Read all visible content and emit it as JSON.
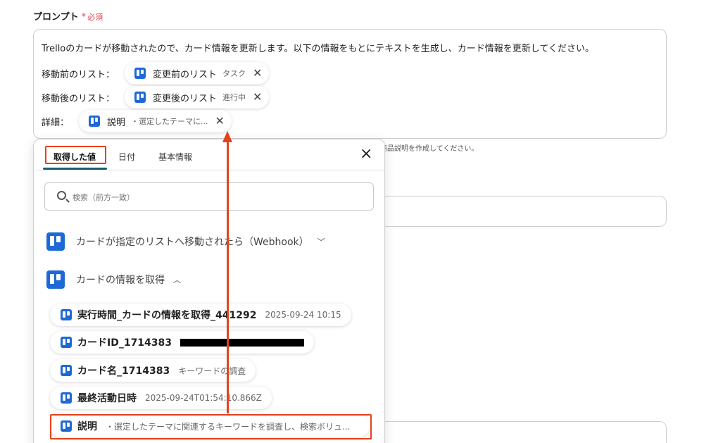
{
  "prompt_field": {
    "label": "プロンプト",
    "required_mark": "*",
    "required_text": "必須",
    "text": "Trelloのカードが移動されたので、カード情報を更新します。以下の情報をもとにテキストを生成し、カード情報を更新してください。",
    "rows": [
      {
        "label": "移動前のリスト：",
        "chip_title": "変更前のリスト",
        "chip_value": "タスク"
      },
      {
        "label": "移動後のリスト：",
        "chip_title": "変更後のリスト",
        "chip_value": "進行中"
      },
      {
        "label": "詳細：",
        "chip_title": "説明",
        "chip_value": "・選定したテーマに..."
      }
    ]
  },
  "helper_text": "商品説明を作成してください。",
  "popup": {
    "tabs": [
      "取得した値",
      "日付",
      "基本情報"
    ],
    "active_tab": "取得した値",
    "close_icon": "×",
    "search_placeholder": "検索（前方一致）",
    "sections": [
      {
        "title": "カードが指定のリストへ移動されたら（Webhook）",
        "state": "collapsed",
        "chevron": "⌄"
      },
      {
        "title": "カードの情報を取得",
        "state": "expanded",
        "chevron": "^"
      }
    ],
    "items": [
      {
        "title": "実行時間_カードの情報を取得_441292",
        "value": "2025-09-24 10:15"
      },
      {
        "title": "カードID_1714383",
        "value": ""
      },
      {
        "title": "カード名_1714383",
        "value": "キーワードの調査"
      },
      {
        "title": "最終活動日時",
        "value": "2025-09-24T01:54:10.866Z"
      },
      {
        "title": "説明",
        "value": "・選定したテーマに関連するキーワードを調査し、検索ボリュ..."
      }
    ]
  },
  "colors": {
    "accent": "#17606e",
    "annotation": "#e8401c",
    "trello": "#1d69d6",
    "required": "#e5484d"
  }
}
